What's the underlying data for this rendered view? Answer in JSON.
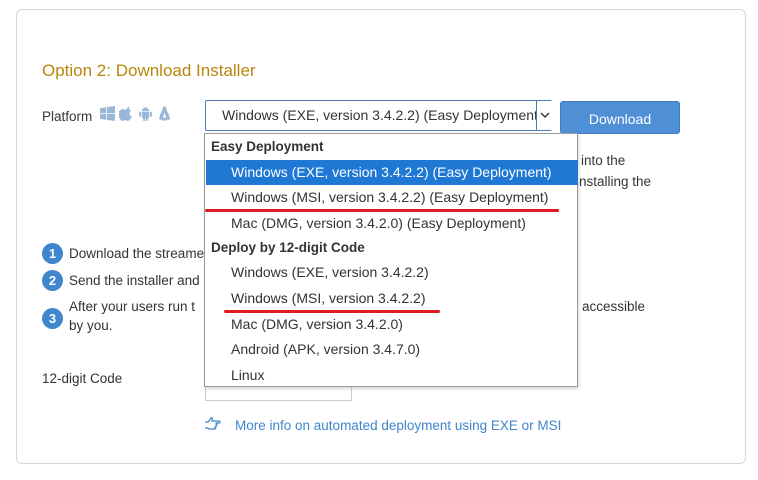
{
  "section": {
    "heading": "Option 2: Download Installer",
    "platform_label": "Platform",
    "platform_icons": [
      "windows-icon",
      "apple-icon",
      "android-icon",
      "linux-icon"
    ]
  },
  "select": {
    "value": "Windows (EXE, version 3.4.2.2) (Easy Deployment)"
  },
  "download_button": "Download",
  "behind": {
    "right_line1": "into the",
    "right_line2": "nstalling the",
    "step1": "Download the streame",
    "step2": "Send the installer and",
    "step3_line1": "After your users run t",
    "step3_line2": "by you.",
    "step3_right": "accessible"
  },
  "steps": [
    "1",
    "2",
    "3"
  ],
  "code_label": "12-digit Code",
  "info_link": "More info on automated deployment using EXE or MSI",
  "dropdown": {
    "group1": "Easy Deployment",
    "group1_options": [
      "Windows (EXE, version 3.4.2.2) (Easy Deployment)",
      "Windows (MSI, version 3.4.2.2) (Easy Deployment)",
      "Mac (DMG, version 3.4.2.0) (Easy Deployment)"
    ],
    "group2": "Deploy by 12-digit Code",
    "group2_options": [
      "Windows (EXE, version 3.4.2.2)",
      "Windows (MSI, version 3.4.2.2)",
      "Mac (DMG, version 3.4.2.0)",
      "Android (APK, version 3.4.7.0)",
      "Linux"
    ]
  },
  "colors": {
    "heading": "#b8860b",
    "accent": "#3f86cc",
    "selected_option": "#1e78d4",
    "annotation": "#e01a22"
  }
}
